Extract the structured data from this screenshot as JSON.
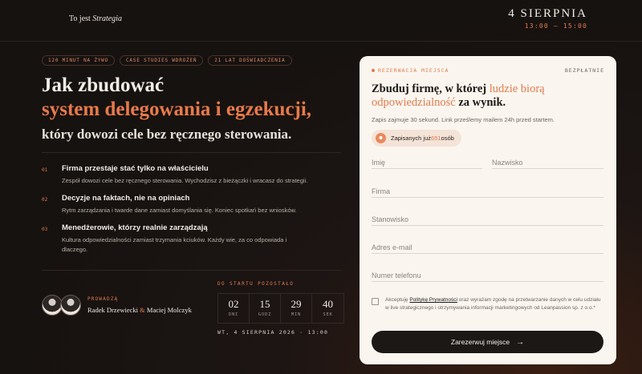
{
  "header": {
    "brand_prefix": "To jest",
    "brand_name": "Strategia",
    "event_date": "4 SIERPNIA",
    "event_time": "13:00 – 15:00"
  },
  "tags": [
    "120 MINUT NA ŻYWO",
    "CASE STUDIES WDROŻEŃ",
    "21 LAT DOŚWIADCZENIA"
  ],
  "headline": {
    "line1": "Jak zbudować",
    "line2": "system delegowania i egzekucji,",
    "line3": "który dowozi cele bez ręcznego sterowania."
  },
  "features": [
    {
      "num": "01",
      "title": "Firma przestaje stać tylko na właścicielu",
      "desc": "Zespół dowozi cele bez ręcznego sterowania. Wychodzisz z bieżączki i wracasz do strategii."
    },
    {
      "num": "02",
      "title": "Decyzje na faktach, nie na opiniach",
      "desc": "Rytm zarządzania i twarde dane zamiast domyślania się. Koniec spotkań bez wniosków."
    },
    {
      "num": "03",
      "title": "Menedżerowie, którzy realnie zarządzają",
      "desc": "Kultura odpowiedzialności zamiast trzymania kciuków. Każdy wie, za co odpowiada i dlaczego."
    }
  ],
  "hosts": {
    "label": "PROWADZĄ",
    "name1": "Radek Drzewiecki",
    "amp": "&",
    "name2": "Maciej Molczyk"
  },
  "countdown": {
    "label": "DO STARTU POZOSTAŁO",
    "units": [
      {
        "value": "02",
        "unit": "DNI"
      },
      {
        "value": "15",
        "unit": "GODZ"
      },
      {
        "value": "29",
        "unit": "MIN"
      },
      {
        "value": "40",
        "unit": "SEK"
      }
    ],
    "date": "WT, 4 SIERPNIA 2026 · 13:00"
  },
  "form": {
    "badge": "REZERWACJA MIEJSCA",
    "free": "BEZPŁATNIE",
    "heading_pre": "Zbuduj firmę, w której ",
    "heading_acc1": "ludzie biorą",
    "heading_acc2": "odpowiedzialność",
    "heading_post": " za wynik.",
    "subtitle": "Zapis zajmuje 30 sekund. Link prześlemy mailem 24h przed startem.",
    "signed_pre": "Zapisanych już ",
    "signed_count": "651",
    "signed_post": " osób",
    "fields": {
      "first_name": "Imię",
      "last_name": "Nazwisko",
      "company": "Firma",
      "position": "Stanowisko",
      "email": "Adres e-mail",
      "phone": "Numer telefonu"
    },
    "consent_pre": "Akceptuję ",
    "consent_link": "Politykę Prywatności",
    "consent_post": " oraz wyrażam zgodę na przetwarzanie danych w celu udziału w live strategicznego i otrzymywania informacji marketingowych od Leanpassion sp. z o.o.*",
    "submit": "Zarezerwuj miejsce"
  },
  "icons": {
    "arrow": "arrow-right-icon",
    "users": "users-icon"
  },
  "colors": {
    "accent": "#e07b4f",
    "background": "#161210",
    "card": "#faf6ef"
  }
}
